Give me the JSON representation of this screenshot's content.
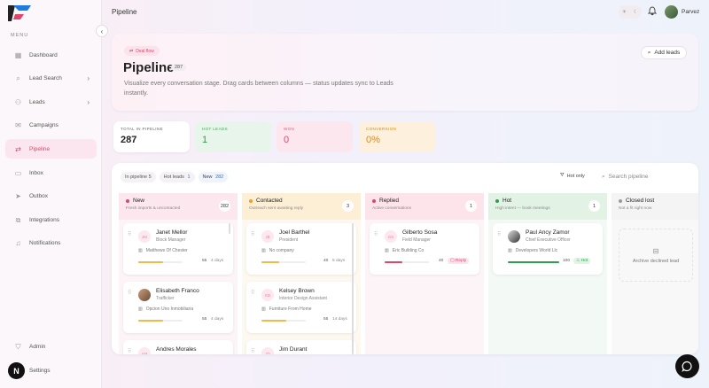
{
  "sidebar": {
    "menu_label": "MENU",
    "items": [
      {
        "label": "Dashboard",
        "icon": "grid-icon"
      },
      {
        "label": "Lead Search",
        "icon": "search-icon"
      },
      {
        "label": "Leads",
        "icon": "users-icon"
      },
      {
        "label": "Campaigns",
        "icon": "mail-icon"
      },
      {
        "label": "Pipeline",
        "icon": "flow-icon"
      },
      {
        "label": "Inbox",
        "icon": "inbox-icon"
      },
      {
        "label": "Outbox",
        "icon": "send-icon"
      },
      {
        "label": "Integrations",
        "icon": "plug-icon"
      },
      {
        "label": "Notifications",
        "icon": "bell-icon"
      },
      {
        "label": "Admin",
        "icon": "shield-icon"
      },
      {
        "label": "Settings",
        "icon": "gear-icon"
      }
    ],
    "avatar_letter": "N"
  },
  "topbar": {
    "title": "Pipeline",
    "user_name": "Parvez"
  },
  "hero": {
    "pill": "Deal flow",
    "title": "Pipeline",
    "count": "287",
    "description": "Visualize every conversation stage. Drag cards between columns — status updates sync to Leads instantly.",
    "add_leads": "Add leads"
  },
  "stats": {
    "total": {
      "label": "TOTAL IN PIPELINE",
      "value": "287"
    },
    "hot": {
      "label": "HOT LEADS",
      "value": "1"
    },
    "won": {
      "label": "WON",
      "value": "0"
    },
    "conversion": {
      "label": "CONVERSION",
      "value": "0%"
    }
  },
  "board": {
    "chips": [
      {
        "label": "In pipeline",
        "count": "5"
      },
      {
        "label": "Hot leads",
        "count": "1"
      },
      {
        "label": "New",
        "count": "282"
      }
    ],
    "hot_only": "Hot only",
    "search_placeholder": "Search pipeline",
    "columns": {
      "new": {
        "name": "New",
        "subtitle": "Fresh imports & uncontacted",
        "count": "282",
        "color": "#e0456e",
        "cards": [
          {
            "initials": "JM",
            "name": "Janet Mellor",
            "role": "Block Manager",
            "company": "Matthews Of Chester",
            "score": "55",
            "age": "4 days",
            "progress": 0.55
          },
          {
            "initials": "",
            "name": "Elisabeth Franco",
            "role": "Trafficker",
            "company": "Opcion Uno Inmobiliaria",
            "score": "55",
            "age": "4 days",
            "progress": 0.55
          },
          {
            "initials": "AM",
            "name": "Andres Morales",
            "role": "",
            "company": "",
            "score": "",
            "age": "",
            "progress": 0
          }
        ]
      },
      "contacted": {
        "name": "Contacted",
        "subtitle": "Outreach sent·awaiting reply",
        "count": "3",
        "color": "#f0a020",
        "cards": [
          {
            "initials": "JB",
            "name": "Joel Barthel",
            "role": "President",
            "company": "No company",
            "score": "40",
            "age": "5 days",
            "progress": 0.4
          },
          {
            "initials": "KB",
            "name": "Kelsey Brown",
            "role": "Interior Design Assistant",
            "company": "Furniture From Home",
            "score": "55",
            "age": "14 days",
            "progress": 0.55
          },
          {
            "initials": "JD",
            "name": "Jim Durant",
            "role": "",
            "company": "",
            "score": "",
            "age": "",
            "progress": 0
          }
        ]
      },
      "replied": {
        "name": "Replied",
        "subtitle": "Active conversations",
        "count": "1",
        "color": "#e0456e",
        "cards": [
          {
            "initials": "GS",
            "name": "Gilberto Sosa",
            "role": "Field Manager",
            "company": "Eric Building Co",
            "score": "40",
            "tag": "Reply",
            "progress": 0.4
          }
        ]
      },
      "hot": {
        "name": "Hot",
        "subtitle": "High intent — book meetings",
        "count": "1",
        "color": "#2f9e4f",
        "cards": [
          {
            "initials": "",
            "name": "Paul Ancy Zamor",
            "role": "Chief Executive Officer",
            "company": "Developers World Llc",
            "score": "100",
            "tag": "Hot",
            "progress": 1.0
          }
        ]
      },
      "closed": {
        "name": "Closed lost",
        "subtitle": "Not a fit right now",
        "color": "#999999",
        "empty_text": "Archive declined lead"
      }
    }
  }
}
